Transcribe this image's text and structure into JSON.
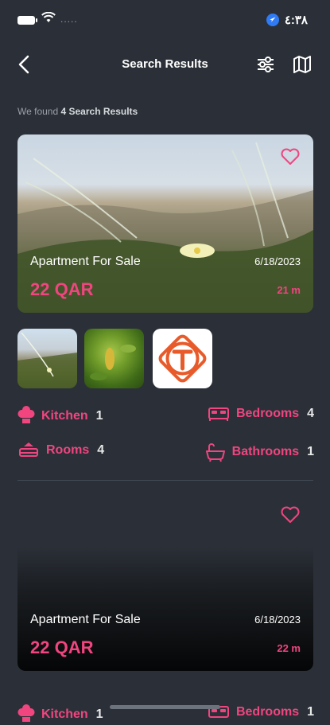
{
  "status_bar": {
    "time": "٤:٣٨",
    "carrier_dots": "....."
  },
  "header": {
    "title": "Search Results"
  },
  "summary": {
    "prefix": "We found ",
    "count_text": "4 Search Results"
  },
  "listings": [
    {
      "title": "Apartment For Sale",
      "date": "6/18/2023",
      "price": "22 QAR",
      "distance": "21 m",
      "features": {
        "kitchen_label": "Kitchen",
        "kitchen_value": "1",
        "bedrooms_label": "Bedrooms",
        "bedrooms_value": "4",
        "rooms_label": "Rooms",
        "rooms_value": "4",
        "bathrooms_label": "Bathrooms",
        "bathrooms_value": "1"
      }
    },
    {
      "title": "Apartment For Sale",
      "date": "6/18/2023",
      "price": "22 QAR",
      "distance": "22 m",
      "features": {
        "kitchen_label": "Kitchen",
        "kitchen_value": "1",
        "bedrooms_label": "Bedrooms",
        "bedrooms_value": "1"
      }
    }
  ],
  "colors": {
    "accent": "#f0457f",
    "background": "#2b3038"
  }
}
